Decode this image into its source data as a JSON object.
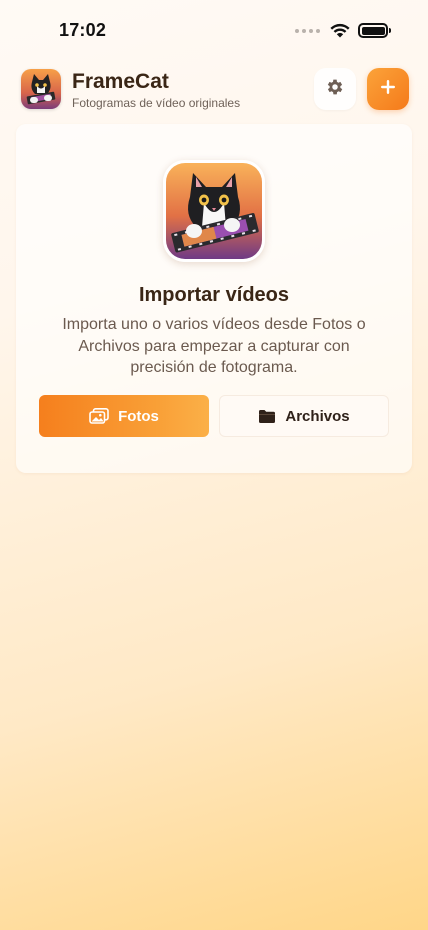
{
  "status_bar": {
    "time": "17:02",
    "icons": [
      "signal-icon",
      "wifi-icon",
      "battery-icon"
    ]
  },
  "header": {
    "app_name": "FrameCat",
    "subtitle": "Fotogramas de vídeo originales",
    "logo_icon": "framecat-logo",
    "settings_icon": "gear-icon",
    "add_icon": "plus-icon"
  },
  "import_card": {
    "artwork_icon": "cat-film-artwork",
    "title": "Importar vídeos",
    "description": "Importa uno o varios vídeos desde Fotos o Archivos para empezar a capturar con precisión de fotograma.",
    "buttons": {
      "photos": {
        "label": "Fotos",
        "icon": "photos-icon"
      },
      "files": {
        "label": "Archivos",
        "icon": "folder-icon"
      }
    }
  },
  "colors": {
    "accent": "#f5841f",
    "accent_light": "#fbb048",
    "text_dark": "#3a2616",
    "text_muted": "#6b5a4f",
    "background_top": "#fffaf5",
    "background_bottom": "#ffd688"
  }
}
